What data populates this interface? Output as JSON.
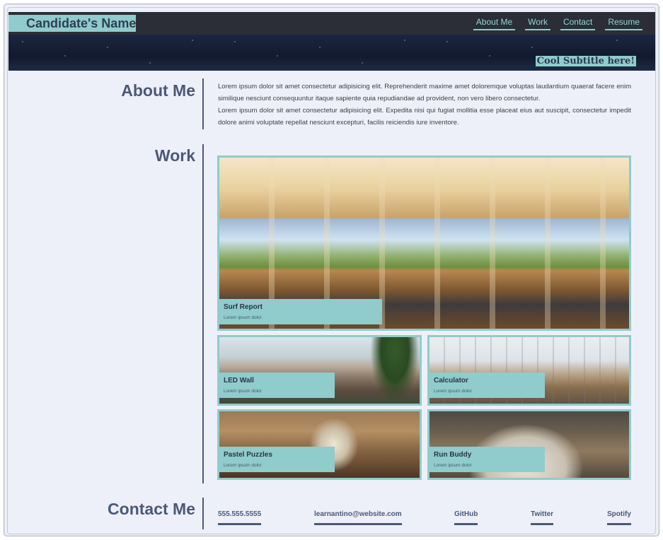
{
  "header": {
    "name": "Candidate's Name",
    "subtitle": "Cool Subtitle here!",
    "nav": [
      "About Me",
      "Work",
      "Contact",
      "Resume"
    ]
  },
  "about": {
    "heading": "About Me",
    "paragraph1": "Lorem ipsum dolor sit amet consectetur adipisicing elit. Reprehenderit maxime amet doloremque voluptas laudantium quaerat facere enim similique nesciunt consequuntur itaque sapiente quia repudiandae ad provident, non vero libero consectetur.",
    "paragraph2": "Lorem ipsum dolor sit amet consectetur adipisicing elit. Expedita nisi qui fugiat mollitia esse placeat eius aut suscipit, consectetur impedit dolore animi voluptate repellat nesciunt excepturi, facilis reiciendis iure inventore."
  },
  "work": {
    "heading": "Work",
    "projects": [
      {
        "title": "Surf Report",
        "subtitle": "Lorem ipsum dolor"
      },
      {
        "title": "LED Wall",
        "subtitle": "Lorem ipsum dolor"
      },
      {
        "title": "Calculator",
        "subtitle": "Lorem ipsum dolor"
      },
      {
        "title": "Pastel Puzzles",
        "subtitle": "Lorem ipsum dolor"
      },
      {
        "title": "Run Buddy",
        "subtitle": "Lorem ipsum dolor"
      }
    ]
  },
  "contact": {
    "heading": "Contact Me",
    "phone": "555.555.5555",
    "email": "learnantino@website.com",
    "github": "GitHub",
    "twitter": "Twitter",
    "spotify": "Spotify"
  },
  "colors": {
    "accent": "#8fcccb",
    "heading": "#4b5978",
    "background": "#eef0f9",
    "header": "#2b2e36"
  }
}
